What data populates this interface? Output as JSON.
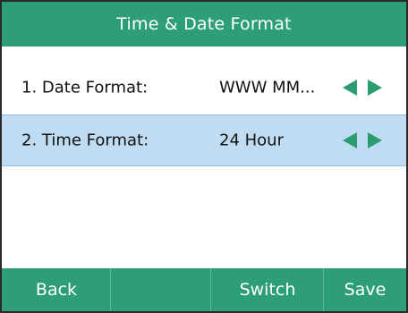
{
  "screen": {
    "title": "Time & Date Format"
  },
  "rows": [
    {
      "label": "1. Date Format:",
      "value": "WWW MM..."
    },
    {
      "label": "2. Time Format:",
      "value": "24 Hour"
    }
  ],
  "softkeys": {
    "back": "Back",
    "blank": "",
    "switch": "Switch",
    "save": "Save"
  },
  "colors": {
    "header": "#2e9e78",
    "selected_row": "#bfdcf3",
    "arrow": "#2b9b70"
  },
  "icons": {
    "left": "triangle-left-icon",
    "right": "triangle-right-icon"
  }
}
